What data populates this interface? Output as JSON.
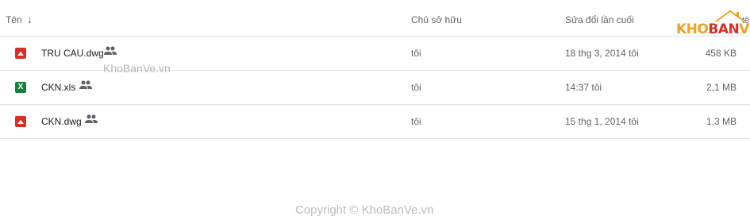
{
  "header": {
    "name_label": "Tên",
    "sort_arrow": "↓",
    "owner_label": "Chủ sở hữu",
    "modified_label": "Sửa đổi lần cuối",
    "edge_label": "tệ"
  },
  "files": [
    {
      "icon": "image-file-icon",
      "name": "TRU CAU.dwg",
      "shared": true,
      "owner": "tôi",
      "modified": "18 thg 3, 2014 tôi",
      "size": "458 KB"
    },
    {
      "icon": "excel-file-icon",
      "icon_glyph": "X",
      "name": "CKN.xls",
      "shared": true,
      "owner": "tôi",
      "modified": "14:37 tôi",
      "size": "2,1 MB"
    },
    {
      "icon": "image-file-icon",
      "name": "CKN.dwg",
      "shared": true,
      "owner": "tôi",
      "modified": "15 thg 1, 2014 tôi",
      "size": "1,3 MB"
    }
  ],
  "watermark": {
    "middle": "KhoBanVe.vn",
    "logo_kho": "KHO",
    "logo_ban": "BAN",
    "logo_ve": "VE",
    "copyright": "Copyright © KhoBanVe.vn"
  },
  "colors": {
    "image_icon": "#d93025",
    "excel_icon": "#188038",
    "logo_orange": "#f0a21f",
    "logo_red": "#d93025"
  }
}
